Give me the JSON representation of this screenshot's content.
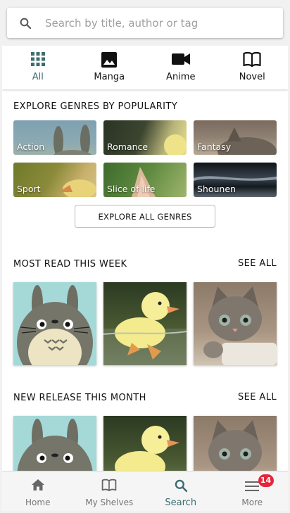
{
  "search": {
    "placeholder": "Search by title, author or tag",
    "value": "",
    "icon": "search-icon"
  },
  "categories": [
    {
      "label": "All",
      "icon": "grid-icon",
      "active": true
    },
    {
      "label": "Manga",
      "icon": "image-icon",
      "active": false
    },
    {
      "label": "Anime",
      "icon": "video-camera-icon",
      "active": false
    },
    {
      "label": "Novel",
      "icon": "book-open-icon",
      "active": false
    }
  ],
  "genres": {
    "title": "EXPLORE GENRES BY POPULARITY",
    "items": [
      {
        "label": "Action"
      },
      {
        "label": "Romance"
      },
      {
        "label": "Fantasy"
      },
      {
        "label": "Sport"
      },
      {
        "label": "Slice of life"
      },
      {
        "label": "Shounen"
      }
    ],
    "button_label": "EXPLORE ALL GENRES"
  },
  "most_read": {
    "title": "MOST READ THIS WEEK",
    "see_all": "SEE ALL",
    "items": [
      {
        "image": "totoro-image"
      },
      {
        "image": "duckling-image"
      },
      {
        "image": "kitten-image"
      }
    ]
  },
  "new_release": {
    "title": "NEW RELEASE THIS MONTH",
    "see_all": "SEE ALL",
    "items": [
      {
        "image": "totoro-image"
      },
      {
        "image": "duckling-image"
      },
      {
        "image": "kitten-image"
      }
    ]
  },
  "bottom_nav": {
    "items": [
      {
        "label": "Home",
        "icon": "home-icon",
        "active": false
      },
      {
        "label": "My Shelves",
        "icon": "book-open-icon",
        "active": false
      },
      {
        "label": "Search",
        "icon": "search-icon",
        "active": true
      },
      {
        "label": "More",
        "icon": "menu-icon",
        "active": false,
        "badge": "14"
      }
    ]
  },
  "colors": {
    "accent": "#3b6c72",
    "badge": "#e4263c"
  }
}
